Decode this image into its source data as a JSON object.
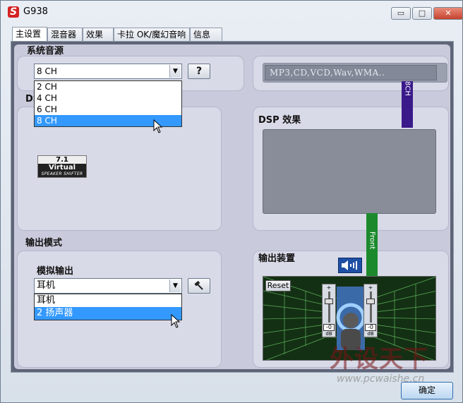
{
  "window": {
    "title": "G938",
    "app_icon_glyph": "S",
    "minimize_glyph": "▭",
    "maximize_glyph": "□",
    "close_glyph": "✕"
  },
  "tabs": [
    "主设置",
    "混音器",
    "效果",
    "卡拉 OK/魔幻音响",
    "信息"
  ],
  "system_source": {
    "heading": "系统音源",
    "selected": "8 CH",
    "options": [
      "2 CH",
      "4 CH",
      "6 CH",
      "8 CH"
    ],
    "help_label": "?",
    "source_display": "MP3,CD,VCD,Wav,WMA..",
    "channel_bar_label": "8CH"
  },
  "dsp": {
    "partial_heading": "DS",
    "badge_line1": "7.1",
    "badge_line2": "Virtual",
    "badge_line3": "SPEAKER SHIFTER",
    "effects_heading": "DSP 效果",
    "front_bar_label": "Front"
  },
  "output_mode": {
    "heading": "输出模式",
    "sub_heading": "模拟输出",
    "selected": "耳机",
    "options": [
      "耳机",
      "2 扬声器"
    ],
    "tool_button": "hammer-icon"
  },
  "output_device": {
    "heading": "输出装置",
    "reset_label": "Reset",
    "slider_plus": "+",
    "slider_minus": "-",
    "left_value": "-0",
    "right_value": "-0",
    "db_label": "dB"
  },
  "footer": {
    "ok_label": "确定"
  },
  "watermark": {
    "text_cn": "外设天下",
    "url": "www.pcwaishe.cn"
  },
  "colors": {
    "selection": "#3399ff",
    "channel_bar": "#3a1a8a",
    "front_bar": "#1c8a2c",
    "room_bg": "#143014"
  }
}
